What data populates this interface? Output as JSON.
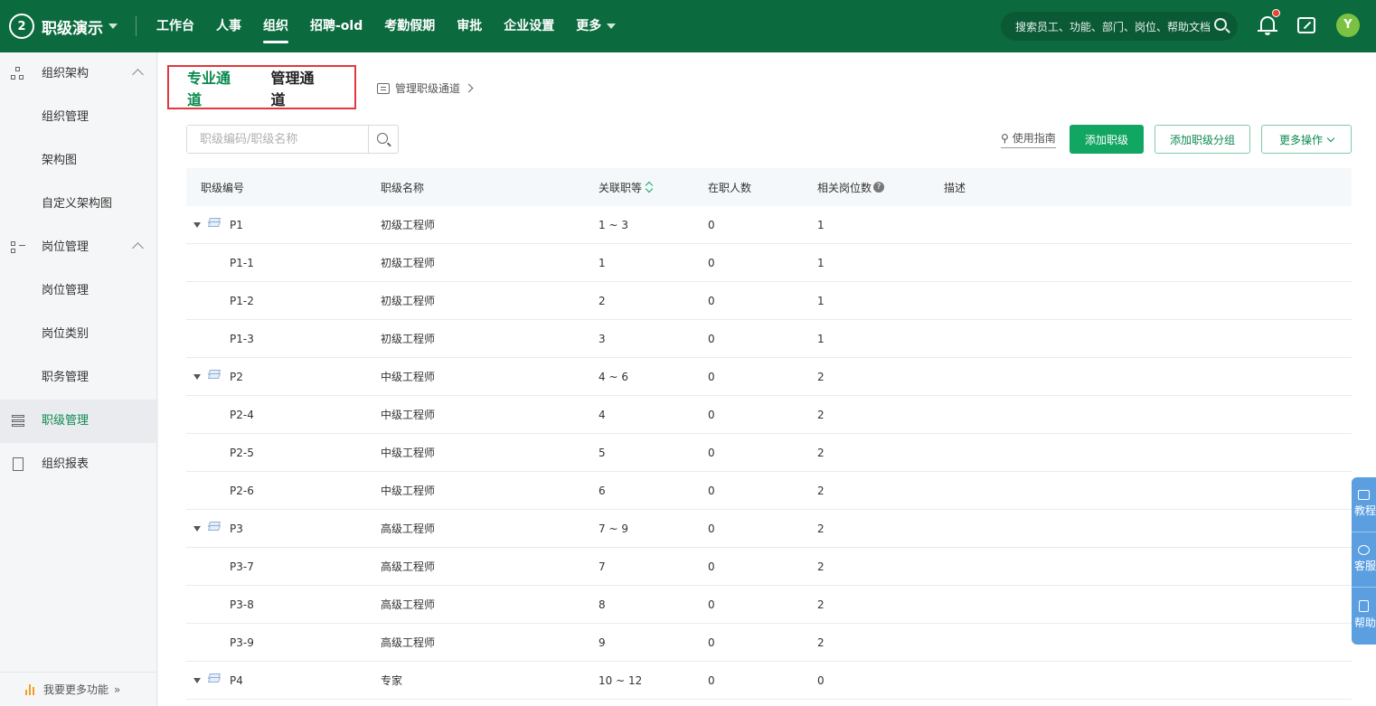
{
  "app": {
    "logo_text": "2",
    "title": "职级演示"
  },
  "nav": [
    {
      "label": "工作台"
    },
    {
      "label": "人事"
    },
    {
      "label": "组织",
      "active": true
    },
    {
      "label": "招聘-old"
    },
    {
      "label": "考勤假期"
    },
    {
      "label": "审批"
    },
    {
      "label": "企业设置"
    },
    {
      "label": "更多"
    }
  ],
  "top_search": {
    "placeholder": "搜索员工、功能、部门、岗位、帮助文档"
  },
  "avatar_text": "Y",
  "sidebar": {
    "group1": "组织架构",
    "group1_items": [
      "组织管理",
      "架构图",
      "自定义架构图"
    ],
    "group2": "岗位管理",
    "group2_items": [
      "岗位管理",
      "岗位类别",
      "职务管理"
    ],
    "active_item": "职级管理",
    "report": "组织报表",
    "bottom": "我要更多功能"
  },
  "tabs": {
    "pro": "专业通道",
    "mgmt": "管理通道"
  },
  "manage_link": "管理职级通道",
  "search": {
    "placeholder": "职级编码/职级名称"
  },
  "guide": "使用指南",
  "buttons": {
    "add": "添加职级",
    "add_group": "添加职级分组",
    "more": "更多操作"
  },
  "table": {
    "headers": {
      "code": "职级编号",
      "name": "职级名称",
      "grade": "关联职等",
      "staff": "在职人数",
      "posts": "相关岗位数",
      "desc": "描述"
    },
    "rows": [
      {
        "code": "P1",
        "name": "初级工程师",
        "grade": "1 ~ 3",
        "staff": "0",
        "posts": "1",
        "group": true
      },
      {
        "code": "P1-1",
        "name": "初级工程师",
        "grade": "1",
        "staff": "0",
        "posts": "1"
      },
      {
        "code": "P1-2",
        "name": "初级工程师",
        "grade": "2",
        "staff": "0",
        "posts": "1"
      },
      {
        "code": "P1-3",
        "name": "初级工程师",
        "grade": "3",
        "staff": "0",
        "posts": "1"
      },
      {
        "code": "P2",
        "name": "中级工程师",
        "grade": "4 ~ 6",
        "staff": "0",
        "posts": "2",
        "group": true
      },
      {
        "code": "P2-4",
        "name": "中级工程师",
        "grade": "4",
        "staff": "0",
        "posts": "2"
      },
      {
        "code": "P2-5",
        "name": "中级工程师",
        "grade": "5",
        "staff": "0",
        "posts": "2"
      },
      {
        "code": "P2-6",
        "name": "中级工程师",
        "grade": "6",
        "staff": "0",
        "posts": "2"
      },
      {
        "code": "P3",
        "name": "高级工程师",
        "grade": "7 ~ 9",
        "staff": "0",
        "posts": "2",
        "group": true
      },
      {
        "code": "P3-7",
        "name": "高级工程师",
        "grade": "7",
        "staff": "0",
        "posts": "2"
      },
      {
        "code": "P3-8",
        "name": "高级工程师",
        "grade": "8",
        "staff": "0",
        "posts": "2"
      },
      {
        "code": "P3-9",
        "name": "高级工程师",
        "grade": "9",
        "staff": "0",
        "posts": "2"
      },
      {
        "code": "P4",
        "name": "专家",
        "grade": "10 ~ 12",
        "staff": "0",
        "posts": "0",
        "group": true
      }
    ]
  },
  "float_panel": [
    "教程",
    "客服",
    "帮助"
  ],
  "colors": {
    "brand": "#0b6b3f",
    "accent": "#12a663",
    "highlight_box": "#e0383e"
  }
}
